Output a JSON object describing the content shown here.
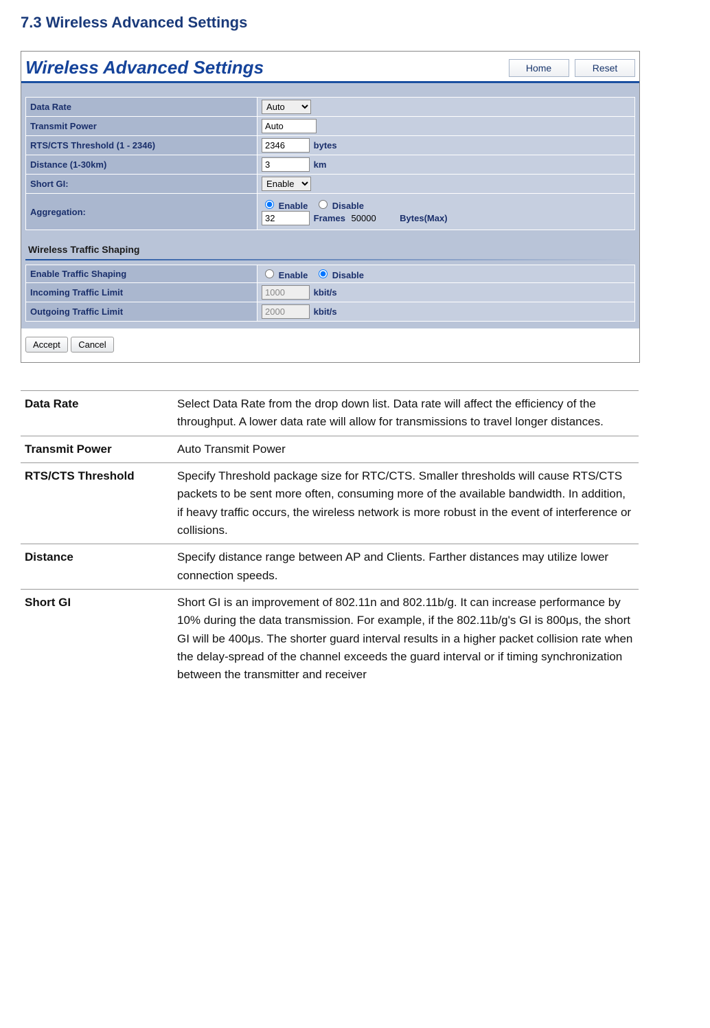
{
  "heading": "7.3 Wireless Advanced Settings",
  "panel": {
    "title": "Wireless Advanced Settings",
    "buttons": {
      "home": "Home",
      "reset": "Reset"
    },
    "rows": {
      "dataRate": {
        "label": "Data Rate",
        "value": "Auto"
      },
      "txPower": {
        "label": "Transmit Power",
        "value": "Auto"
      },
      "rtscts": {
        "label": "RTS/CTS Threshold (1 - 2346)",
        "value": "2346",
        "unit": "bytes"
      },
      "distance": {
        "label": "Distance (1-30km)",
        "value": "3",
        "unit": "km"
      },
      "shortGI": {
        "label": "Short GI:",
        "value": "Enable"
      },
      "aggregation": {
        "label": "Aggregation:",
        "enable": "Enable",
        "disable": "Disable",
        "frames": "32",
        "framesUnit": "Frames",
        "bytes": "50000",
        "bytesUnit": "Bytes(Max)"
      }
    },
    "shapingTitle": "Wireless Traffic Shaping",
    "shaping": {
      "enable": {
        "label": "Enable Traffic Shaping",
        "opt1": "Enable",
        "opt2": "Disable"
      },
      "incoming": {
        "label": "Incoming Traffic Limit",
        "value": "1000",
        "unit": "kbit/s"
      },
      "outgoing": {
        "label": "Outgoing Traffic Limit",
        "value": "2000",
        "unit": "kbit/s"
      }
    },
    "footer": {
      "accept": "Accept",
      "cancel": "Cancel"
    }
  },
  "desc": [
    {
      "term": "Data Rate",
      "defn": "Select Data Rate from the drop down list. Data rate will affect the efficiency of the throughput. A lower data rate will allow for transmissions to travel longer distances."
    },
    {
      "term": "Transmit Power",
      "defn": "Auto Transmit Power"
    },
    {
      "term": "RTS/CTS Threshold",
      "defn": "Specify Threshold package size for RTC/CTS. Smaller thresholds will cause RTS/CTS packets to be sent more often, consuming more of the available bandwidth. In addition, if heavy traffic occurs, the wireless network is more robust in the event of interference or collisions."
    },
    {
      "term": "Distance",
      "defn": "Specify distance range between AP and Clients. Farther distances may utilize lower connection speeds."
    },
    {
      "term": "Short GI",
      "defn": "Short GI is an improvement of 802.11n and 802.11b/g. It can increase performance by 10% during the data transmission. For example, if the 802.11b/g's GI is 800μs, the short GI will be 400μs. The shorter guard interval results in a higher packet collision rate when the delay-spread of the channel exceeds the guard interval or if timing synchronization between the transmitter and receiver"
    }
  ]
}
